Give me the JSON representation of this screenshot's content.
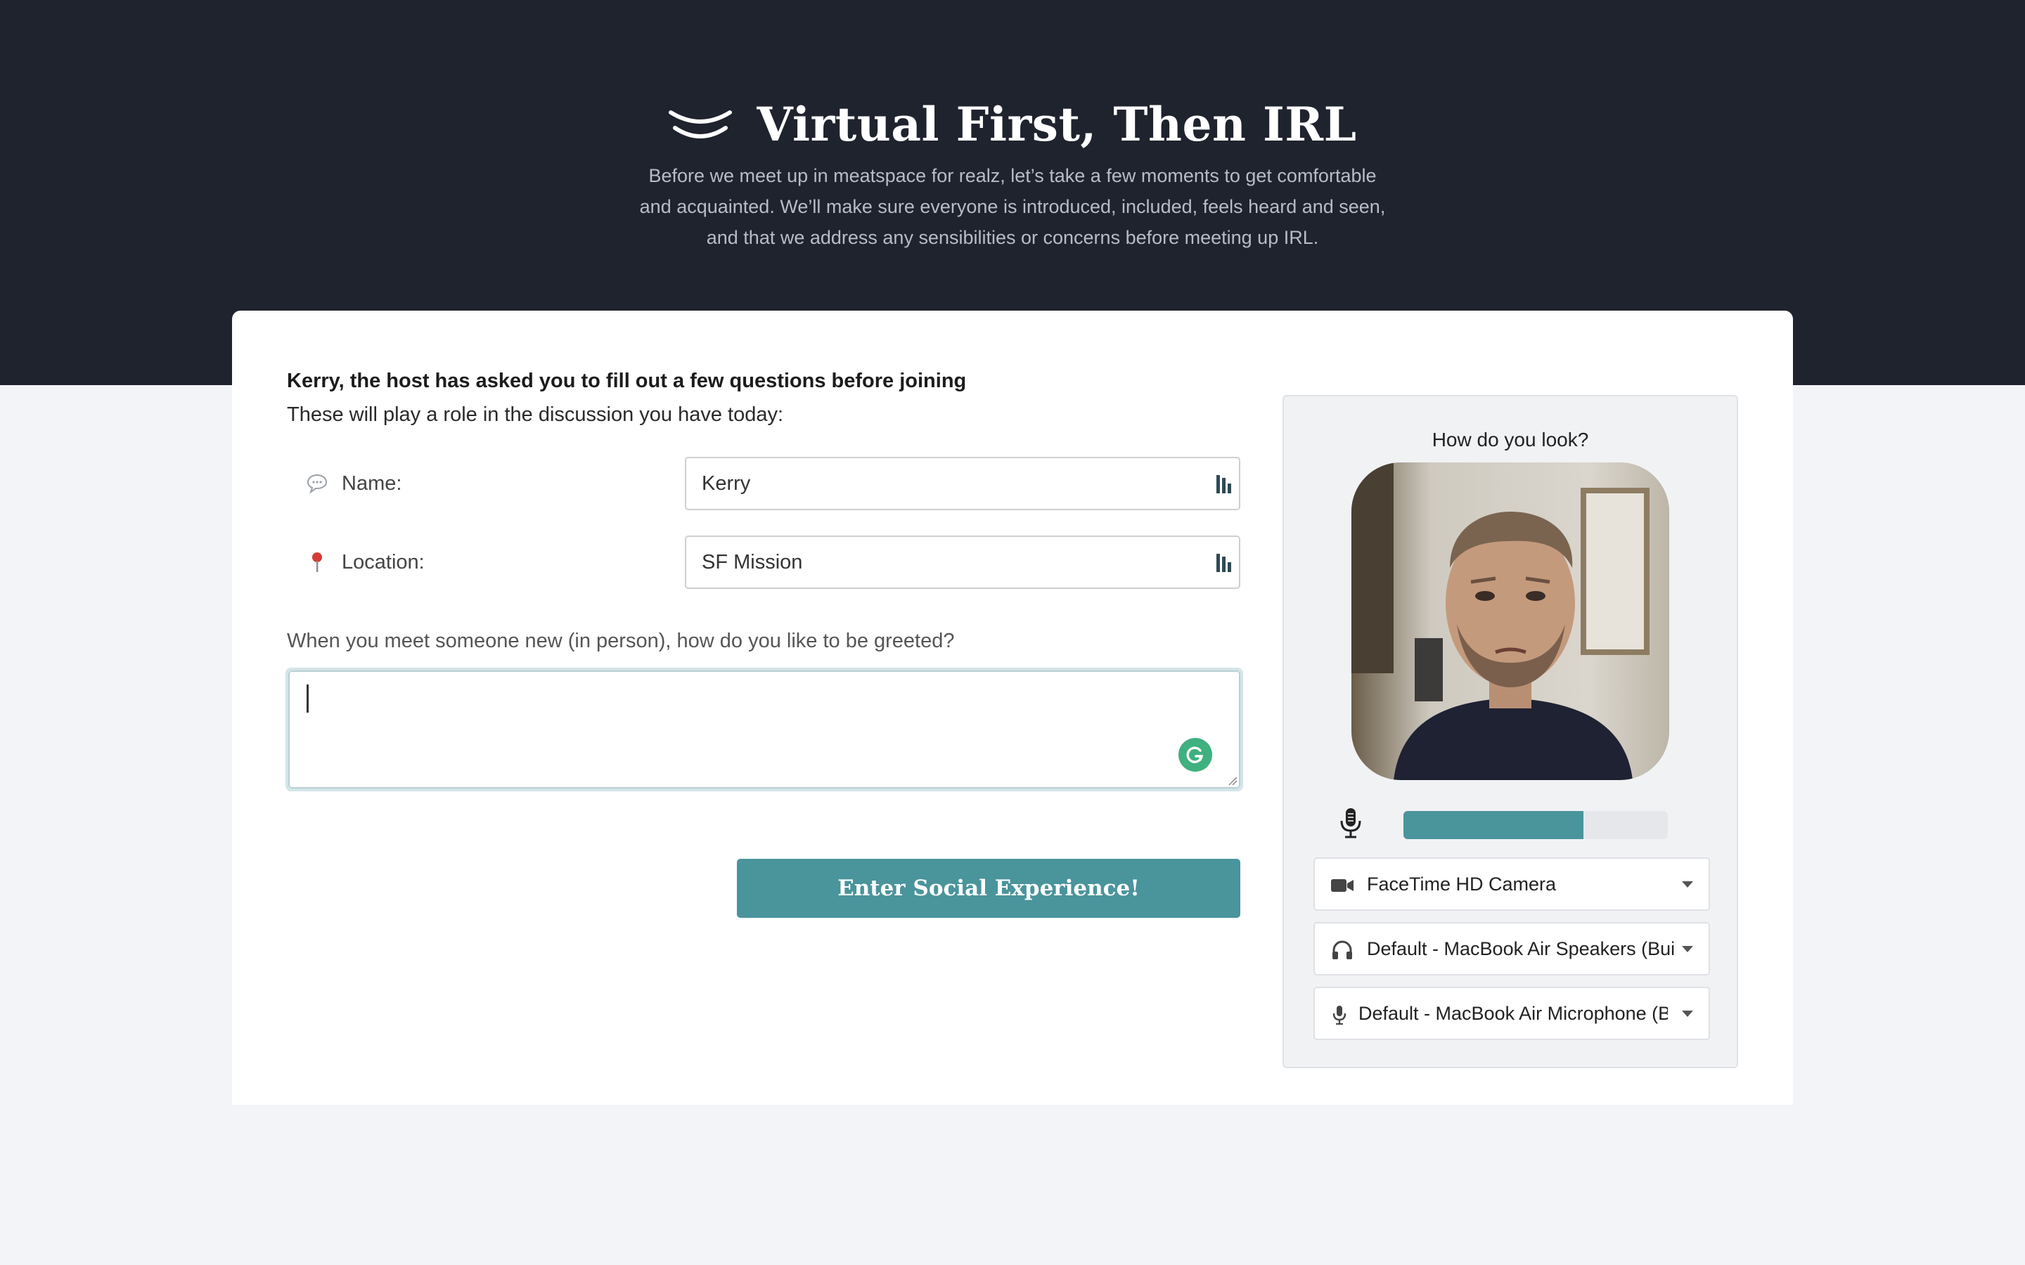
{
  "hero": {
    "title": "Virtual First, Then IRL",
    "subtitle_lines": [
      "Before we meet up in meatspace for realz, let’s take a few moments to get comfortable",
      "and acquainted. We’ll make sure everyone is introduced, included, feels heard and seen,",
      "and that we address any sensibilities or concerns before meeting up IRL."
    ],
    "logo_icon": "smile-waves-logo"
  },
  "form": {
    "heading": "Kerry, the host has asked you to fill out a few questions before joining",
    "subheading": "These will play a role in the discussion you have today:",
    "fields": [
      {
        "icon": "speech-bubble-icon",
        "label": "Name:",
        "value": "Kerry"
      },
      {
        "icon": "pin-icon",
        "label": "Location:",
        "value": "SF Mission"
      }
    ],
    "question": "When you meet someone new (in person), how do you like to be greeted?",
    "answer": "",
    "submit_label": "Enter Social Experience!"
  },
  "preview": {
    "title": "How do you look?",
    "mic_level_fraction": 0.68,
    "devices": [
      {
        "icon": "video-camera-icon",
        "label": "FaceTime HD Camera"
      },
      {
        "icon": "headphones-icon",
        "label": "Default - MacBook Air Speakers (Built-in)"
      },
      {
        "icon": "microphone-icon",
        "label": "Default - MacBook Air Microphone (Built-in)"
      }
    ]
  },
  "colors": {
    "hero_bg": "#1f232e",
    "accent": "#4a949c",
    "page_bg": "#f2f4f8",
    "grammarly": "#3fb07f"
  }
}
